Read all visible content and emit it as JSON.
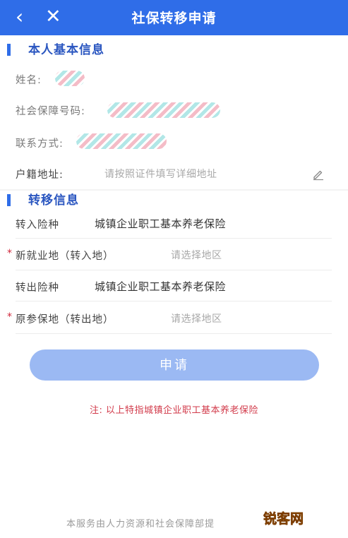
{
  "header": {
    "title": "社保转移申请",
    "back_icon": "‹",
    "close_icon": "✕"
  },
  "personal_section": {
    "title": "本人基本信息",
    "name_label": "姓名:",
    "ssn_label": "社会保障号码:",
    "contact_label": "联系方式:",
    "address_label": "户籍地址:",
    "address_placeholder": "请按照证件填写详细地址"
  },
  "transfer_section": {
    "title": "转移信息",
    "in_type_label": "转入险种",
    "in_type_value": "城镇企业职工基本养老保险",
    "new_location_required": "*",
    "new_location_label": "新就业地（转入地）",
    "new_location_placeholder": "请选择地区",
    "out_type_label": "转出险种",
    "out_type_value": "城镇企业职工基本养老保险",
    "orig_location_required": "*",
    "orig_location_label": "原参保地（转出地）",
    "orig_location_placeholder": "请选择地区"
  },
  "apply_button": "申请",
  "note": "注:  以上特指城镇企业职工基本养老保险",
  "footer": "本服务由人力资源和社会保障部提",
  "watermark": "锐客网",
  "colors": {
    "header_bg": "#2f6de8",
    "section_title": "#2a56c0",
    "button_bg": "#9bb9f3",
    "note": "#d23b4b"
  }
}
